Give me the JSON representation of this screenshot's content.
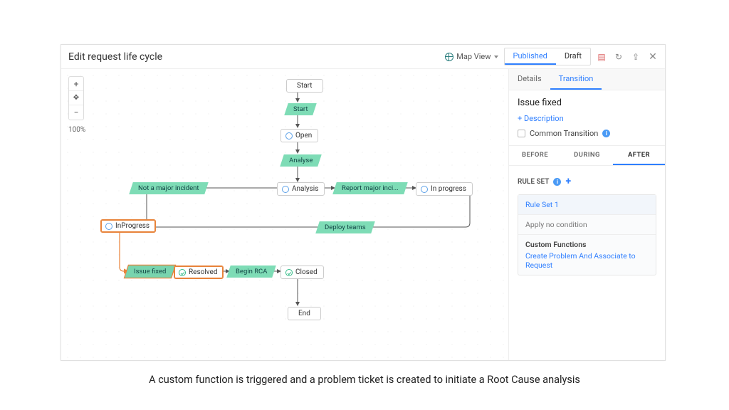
{
  "header": {
    "title": "Edit request life cycle",
    "map_view": "Map View",
    "tabs": {
      "published": "Published",
      "draft": "Draft"
    }
  },
  "zoom": {
    "pct": "100%"
  },
  "nodes": {
    "start_term": "Start",
    "start": "Start",
    "open": "Open",
    "analyse": "Analyse",
    "analysis": "Analysis",
    "not_major": "Not a major incident",
    "report_major": "Report major inci...",
    "in_progress_right": "In progress",
    "deploy_teams": "Deploy teams",
    "in_progress_left": "InProgress",
    "issue_fixed": "Issue fixed",
    "resolved": "Resolved",
    "begin_rca": "Begin RCA",
    "closed": "Closed",
    "end": "End"
  },
  "side": {
    "tabs": {
      "details": "Details",
      "transition": "Transition"
    },
    "title": "Issue fixed",
    "add_desc": "+ Description",
    "common": "Common Transition",
    "sub": {
      "before": "BEFORE",
      "during": "DURING",
      "after": "AFTER"
    },
    "ruleset_label": "RULE SET",
    "rule1": "Rule Set 1",
    "cond": "Apply no condition",
    "cf_label": "Custom Functions",
    "cf_link": "Create Problem And Associate to Request"
  },
  "caption": "A custom function is triggered and a problem ticket is created to initiate a Root Cause analysis"
}
